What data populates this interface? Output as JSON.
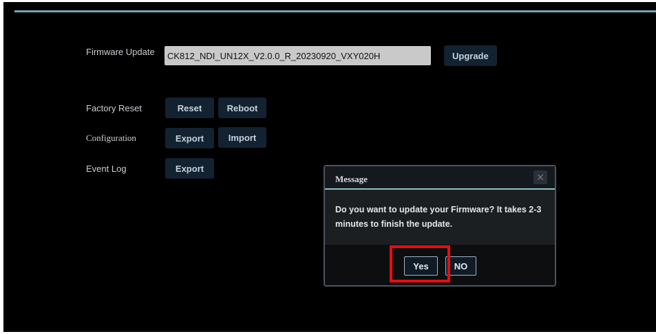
{
  "firmware": {
    "label": "Firmware Update",
    "value": "CK812_NDI_UN12X_V2.0.0_R_20230920_VXY020H",
    "upgrade_label": "Upgrade"
  },
  "factory_reset": {
    "label": "Factory Reset",
    "reset_label": "Reset",
    "reboot_label": "Reboot"
  },
  "configuration": {
    "label": "Configuration",
    "export_label": "Export",
    "import_label": "Import"
  },
  "event_log": {
    "label": "Event Log",
    "export_label": "Export"
  },
  "dialog": {
    "title": "Message",
    "close_glyph": "✕",
    "message": "Do you want to update your Firmware? It takes 2-3 minutes to finish the update.",
    "yes_label": "Yes",
    "no_label": "NO"
  },
  "colors": {
    "background": "#000000",
    "accent_rule": "#6fa9b3",
    "button_bg": "#132230",
    "highlight": "#ee0a0f"
  }
}
